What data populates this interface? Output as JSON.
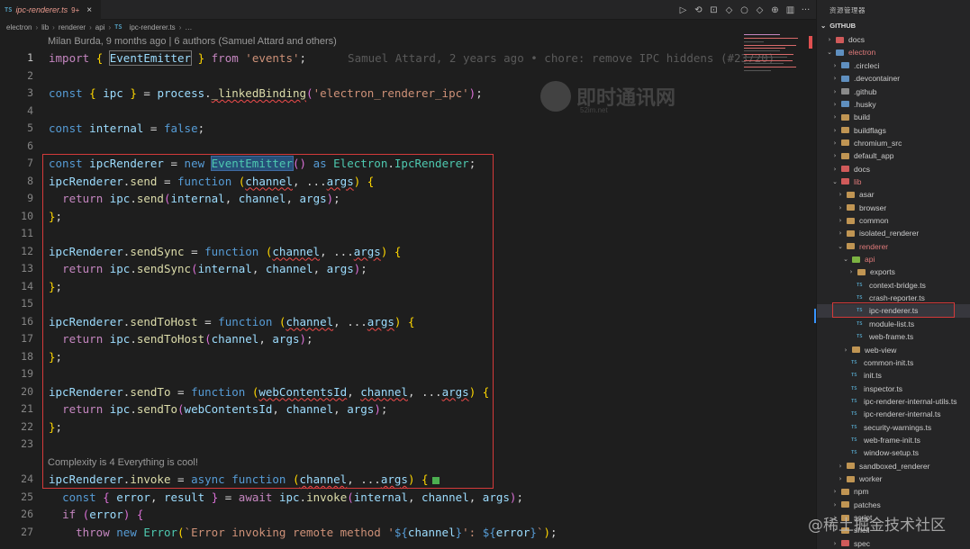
{
  "tab": {
    "badge": "TS",
    "name": "ipc-renderer.ts",
    "count": "9+",
    "close": "×"
  },
  "editor_actions": [
    "▷",
    "⟲",
    "⊡",
    "◇",
    "○",
    "◇",
    "⊕",
    "▥",
    "···"
  ],
  "breadcrumb": [
    "electron",
    "lib",
    "renderer",
    "api",
    "ipc-renderer.ts",
    "…"
  ],
  "breadcrumb_sep": "›",
  "blame_header": "Milan Burda, 9 months ago | 6 authors (Samuel Attard and others)",
  "inline_blame": "Samuel Attard, 2 years ago • chore: remove IPC hiddens (#23720)",
  "complexity": "Complexity is 4 Everything is cool!",
  "line_numbers": [
    "1",
    "2",
    "3",
    "4",
    "5",
    "6",
    "7",
    "8",
    "9",
    "10",
    "11",
    "12",
    "13",
    "14",
    "15",
    "16",
    "17",
    "18",
    "19",
    "20",
    "21",
    "22",
    "23",
    "24",
    "25",
    "26",
    "27"
  ],
  "code_lines": [
    "import { EventEmitter } from 'events';",
    "",
    "const { ipc } = process._linkedBinding('electron_renderer_ipc');",
    "",
    "const internal = false;",
    "",
    "const ipcRenderer = new EventEmitter() as Electron.IpcRenderer;",
    "ipcRenderer.send = function (channel, ...args) {",
    "  return ipc.send(internal, channel, args);",
    "};",
    "",
    "ipcRenderer.sendSync = function (channel, ...args) {",
    "  return ipc.sendSync(internal, channel, args);",
    "};",
    "",
    "ipcRenderer.sendToHost = function (channel, ...args) {",
    "  return ipc.sendToHost(channel, args);",
    "};",
    "",
    "ipcRenderer.sendTo = function (webContentsId, channel, ...args) {",
    "  return ipc.sendTo(webContentsId, channel, args);",
    "};",
    "",
    "ipcRenderer.invoke = async function (channel, ...args) {",
    "  const { error, result } = await ipc.invoke(internal, channel, args);",
    "  if (error) {",
    "    throw new Error(`Error invoking remote method '${channel}': ${error}`);"
  ],
  "sidebar": {
    "title": "资源管理器",
    "section": "GITHUB",
    "items": [
      {
        "label": "docs",
        "depth": 1,
        "chev": "›",
        "icon": "folder-red"
      },
      {
        "label": "electron",
        "depth": 1,
        "chev": "⌄",
        "icon": "folder-blue",
        "red": true
      },
      {
        "label": ".circleci",
        "depth": 2,
        "chev": "›",
        "icon": "folder-blue"
      },
      {
        "label": ".devcontainer",
        "depth": 2,
        "chev": "›",
        "icon": "folder-blue"
      },
      {
        "label": ".github",
        "depth": 2,
        "chev": "›",
        "icon": "folder-gray"
      },
      {
        "label": ".husky",
        "depth": 2,
        "chev": "›",
        "icon": "folder-blue"
      },
      {
        "label": "build",
        "depth": 2,
        "chev": "›",
        "icon": "folder"
      },
      {
        "label": "buildflags",
        "depth": 2,
        "chev": "›",
        "icon": "folder"
      },
      {
        "label": "chromium_src",
        "depth": 2,
        "chev": "›",
        "icon": "folder"
      },
      {
        "label": "default_app",
        "depth": 2,
        "chev": "›",
        "icon": "folder"
      },
      {
        "label": "docs",
        "depth": 2,
        "chev": "›",
        "icon": "folder-red"
      },
      {
        "label": "lib",
        "depth": 2,
        "chev": "⌄",
        "icon": "folder-red",
        "red": true
      },
      {
        "label": "asar",
        "depth": 3,
        "chev": "›",
        "icon": "folder"
      },
      {
        "label": "browser",
        "depth": 3,
        "chev": "›",
        "icon": "folder"
      },
      {
        "label": "common",
        "depth": 3,
        "chev": "›",
        "icon": "folder"
      },
      {
        "label": "isolated_renderer",
        "depth": 3,
        "chev": "›",
        "icon": "folder"
      },
      {
        "label": "renderer",
        "depth": 3,
        "chev": "⌄",
        "icon": "folder",
        "red": true
      },
      {
        "label": "api",
        "depth": 4,
        "chev": "⌄",
        "icon": "folder-green",
        "red": true
      },
      {
        "label": "exports",
        "depth": 5,
        "chev": "›",
        "icon": "folder"
      },
      {
        "label": "context-bridge.ts",
        "depth": 5,
        "chev": "",
        "icon": "ts"
      },
      {
        "label": "crash-reporter.ts",
        "depth": 5,
        "chev": "",
        "icon": "ts"
      },
      {
        "label": "ipc-renderer.ts",
        "depth": 5,
        "chev": "",
        "icon": "ts",
        "sel": true
      },
      {
        "label": "module-list.ts",
        "depth": 5,
        "chev": "",
        "icon": "ts"
      },
      {
        "label": "web-frame.ts",
        "depth": 5,
        "chev": "",
        "icon": "ts"
      },
      {
        "label": "web-view",
        "depth": 4,
        "chev": "›",
        "icon": "folder"
      },
      {
        "label": "common-init.ts",
        "depth": 4,
        "chev": "",
        "icon": "ts"
      },
      {
        "label": "init.ts",
        "depth": 4,
        "chev": "",
        "icon": "ts"
      },
      {
        "label": "inspector.ts",
        "depth": 4,
        "chev": "",
        "icon": "ts"
      },
      {
        "label": "ipc-renderer-internal-utils.ts",
        "depth": 4,
        "chev": "",
        "icon": "ts"
      },
      {
        "label": "ipc-renderer-internal.ts",
        "depth": 4,
        "chev": "",
        "icon": "ts"
      },
      {
        "label": "security-warnings.ts",
        "depth": 4,
        "chev": "",
        "icon": "ts"
      },
      {
        "label": "web-frame-init.ts",
        "depth": 4,
        "chev": "",
        "icon": "ts"
      },
      {
        "label": "window-setup.ts",
        "depth": 4,
        "chev": "",
        "icon": "ts"
      },
      {
        "label": "sandboxed_renderer",
        "depth": 3,
        "chev": "›",
        "icon": "folder"
      },
      {
        "label": "worker",
        "depth": 3,
        "chev": "›",
        "icon": "folder"
      },
      {
        "label": "npm",
        "depth": 2,
        "chev": "›",
        "icon": "folder"
      },
      {
        "label": "patches",
        "depth": 2,
        "chev": "›",
        "icon": "folder"
      },
      {
        "label": "script",
        "depth": 2,
        "chev": "›",
        "icon": "folder"
      },
      {
        "label": "shell",
        "depth": 2,
        "chev": "›",
        "icon": "folder"
      },
      {
        "label": "spec",
        "depth": 2,
        "chev": "›",
        "icon": "folder-red"
      }
    ]
  },
  "watermark": {
    "text": "即时通讯网",
    "sub": "52im.net"
  },
  "juejin_watermark": "@稀土掘金技术社区"
}
